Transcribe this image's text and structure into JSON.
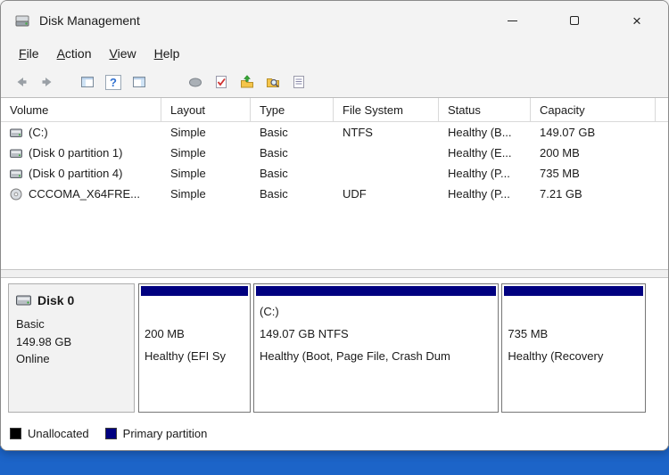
{
  "colors": {
    "desktop": "#1c64c8",
    "primary_partition": "#000080",
    "unallocated": "#000000"
  },
  "titlebar": {
    "title": "Disk Management",
    "controls": {
      "close_glyph": "×"
    }
  },
  "menu": {
    "items": [
      {
        "label": "File"
      },
      {
        "label": "Action"
      },
      {
        "label": "View"
      },
      {
        "label": "Help"
      }
    ]
  },
  "toolbar": {
    "icons": [
      {
        "name": "back-icon"
      },
      {
        "name": "forward-icon"
      },
      {
        "name": "show-console-tree-icon"
      },
      {
        "name": "help-icon",
        "glyph": "?"
      },
      {
        "name": "show-action-pane-icon"
      },
      {
        "name": "properties-icon"
      },
      {
        "name": "check-disk-icon"
      },
      {
        "name": "move-up-icon"
      },
      {
        "name": "explore-icon"
      },
      {
        "name": "export-list-icon"
      }
    ]
  },
  "volume_table": {
    "columns": [
      "Volume",
      "Layout",
      "Type",
      "File System",
      "Status",
      "Capacity"
    ],
    "rows": [
      {
        "icon": "hard-disk",
        "volume": "(C:)",
        "layout": "Simple",
        "type": "Basic",
        "file_system": "NTFS",
        "status": "Healthy (B...",
        "capacity": "149.07 GB"
      },
      {
        "icon": "hard-disk",
        "volume": "(Disk 0 partition 1)",
        "layout": "Simple",
        "type": "Basic",
        "file_system": "",
        "status": "Healthy (E...",
        "capacity": "200 MB"
      },
      {
        "icon": "hard-disk",
        "volume": "(Disk 0 partition 4)",
        "layout": "Simple",
        "type": "Basic",
        "file_system": "",
        "status": "Healthy (P...",
        "capacity": "735 MB"
      },
      {
        "icon": "cd-rom",
        "volume": "CCCOMA_X64FRE...",
        "layout": "Simple",
        "type": "Basic",
        "file_system": "UDF",
        "status": "Healthy (P...",
        "capacity": "7.21 GB"
      }
    ]
  },
  "disk_panel": {
    "name": "Disk 0",
    "type": "Basic",
    "size": "149.98 GB",
    "status": "Online",
    "partitions": [
      {
        "name": "",
        "size": "200 MB",
        "status": "Healthy (EFI Sy",
        "width": "21.5%"
      },
      {
        "name": "(C:)",
        "size": "149.07 GB NTFS",
        "status": "Healthy (Boot, Page File, Crash Dum",
        "width": "47%"
      },
      {
        "name": "",
        "size": "735 MB",
        "status": "Healthy (Recovery",
        "width": "27.5%"
      }
    ]
  },
  "legend": {
    "items": [
      {
        "label": "Unallocated",
        "color": "#000000"
      },
      {
        "label": "Primary partition",
        "color": "#000080"
      }
    ]
  }
}
